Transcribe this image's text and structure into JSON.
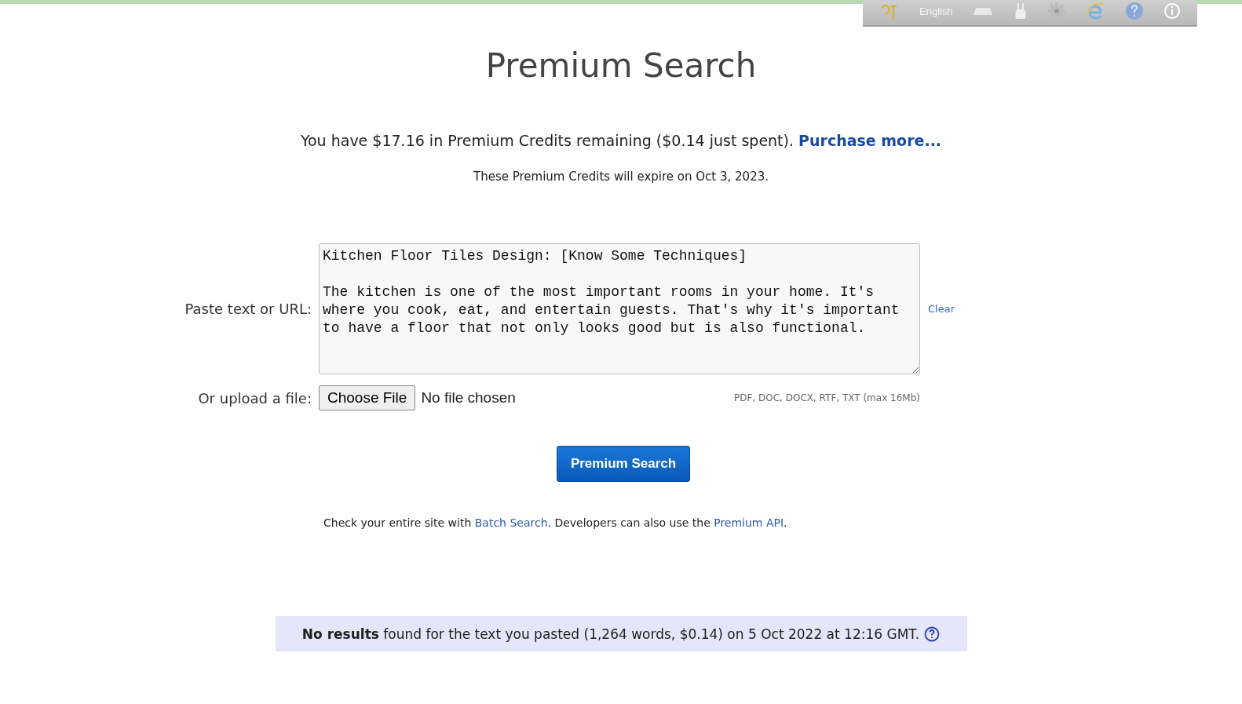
{
  "language_bar": {
    "language": "English"
  },
  "title": "Premium Search",
  "credits": {
    "text": "You have $17.16 in Premium Credits remaining ($0.14 just spent).",
    "link": "Purchase more..."
  },
  "expiry": "These Premium Credits will expire on Oct 3, 2023.",
  "form": {
    "text_label": "Paste text or URL:",
    "text_value": "Kitchen Floor Tiles Design: [Know Some Techniques]\n\nThe kitchen is one of the most important rooms in your home. It's where you cook, eat, and entertain guests. That's why it's important to have a floor that not only looks good but is also functional.",
    "clear": "Clear",
    "upload_label": "Or upload a file:",
    "choose_button": "Choose File",
    "file_status": "No file chosen",
    "formats": "PDF, DOC, DOCX, RTF, TXT (max 16Mb)",
    "submit": "Premium Search"
  },
  "footer_note": [
    {
      "kind": "text",
      "text": "Check your entire site with "
    },
    {
      "kind": "link",
      "text": "Batch Search"
    },
    {
      "kind": "text",
      "text": ". Developers can also use the "
    },
    {
      "kind": "link",
      "text": "Premium API"
    },
    {
      "kind": "text",
      "text": "."
    }
  ],
  "result": {
    "bold": "No results",
    "text": "found for the text you pasted (1,264 words, $0.14) on 5 Oct 2022 at 12:16 GMT."
  }
}
